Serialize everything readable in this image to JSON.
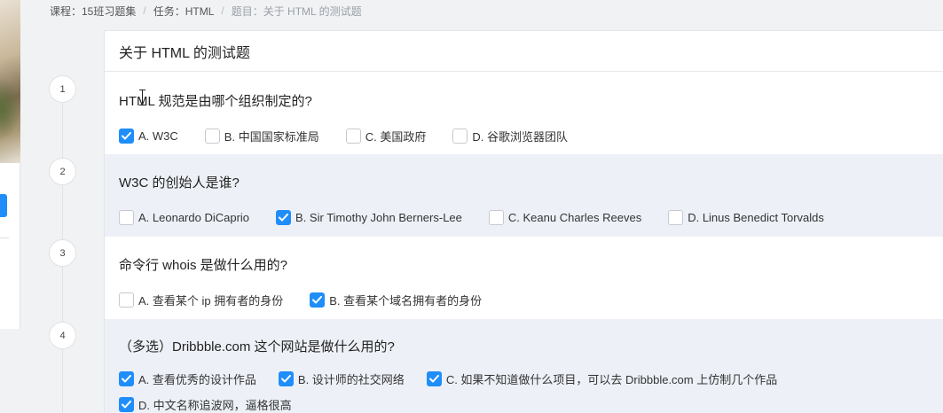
{
  "breadcrumb": [
    {
      "label": "课程：15班习题集"
    },
    {
      "label": "任务：HTML"
    },
    {
      "label": "题目：关于 HTML 的测试题"
    }
  ],
  "breadcrumb_separator": "/",
  "quiz": {
    "title": "关于 HTML 的测试题",
    "questions": [
      {
        "number": "1",
        "text": "HTML 规范是由哪个组织制定的?",
        "options": [
          {
            "label": "A. W3C",
            "checked": true
          },
          {
            "label": "B. 中国国家标准局",
            "checked": false
          },
          {
            "label": "C. 美国政府",
            "checked": false
          },
          {
            "label": "D. 谷歌浏览器团队",
            "checked": false
          }
        ]
      },
      {
        "number": "2",
        "text": "W3C 的创始人是谁?",
        "options": [
          {
            "label": "A. Leonardo DiCaprio",
            "checked": false
          },
          {
            "label": "B. Sir Timothy John Berners-Lee",
            "checked": true
          },
          {
            "label": "C. Keanu Charles Reeves",
            "checked": false
          },
          {
            "label": "D. Linus Benedict Torvalds",
            "checked": false
          }
        ]
      },
      {
        "number": "3",
        "text": "命令行 whois 是做什么用的?",
        "options": [
          {
            "label": "A. 查看某个 ip 拥有者的身份",
            "checked": false
          },
          {
            "label": "B. 查看某个域名拥有者的身份",
            "checked": true
          }
        ]
      },
      {
        "number": "4",
        "text": "（多选）Dribbble.com 这个网站是做什么用的?",
        "options": [
          {
            "label": "A. 查看优秀的设计作品",
            "checked": true
          },
          {
            "label": "B. 设计师的社交网络",
            "checked": true
          },
          {
            "label": "C. 如果不知道做什么项目，可以去 Dribbble.com 上仿制几个作品",
            "checked": true
          },
          {
            "label": "D. 中文名称追波网，逼格很高",
            "checked": true
          }
        ]
      }
    ]
  },
  "colors": {
    "accent": "#1f8efa",
    "alt_row": "#edf1f7",
    "page_background": "#f1f2f4"
  },
  "icons": {
    "checkbox_checked": "checkmark-icon",
    "cursor": "text-cursor-icon"
  }
}
